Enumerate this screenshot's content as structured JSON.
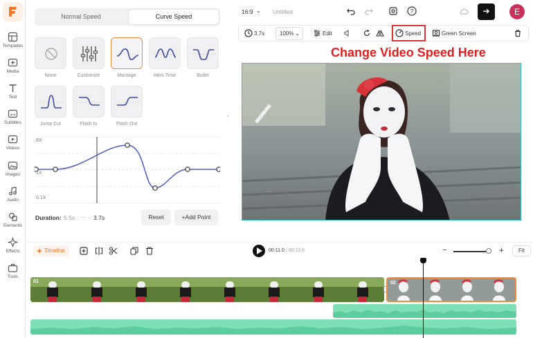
{
  "sidebar": {
    "items": [
      {
        "label": "Templates",
        "icon": "templates-icon"
      },
      {
        "label": "Media",
        "icon": "media-icon"
      },
      {
        "label": "Text",
        "icon": "text-icon"
      },
      {
        "label": "Subtitles",
        "icon": "subtitles-icon"
      },
      {
        "label": "Videos",
        "icon": "videos-icon"
      },
      {
        "label": "Images",
        "icon": "images-icon"
      },
      {
        "label": "Audio",
        "icon": "audio-icon"
      },
      {
        "label": "Elements",
        "icon": "elements-icon"
      },
      {
        "label": "Effects",
        "icon": "effects-icon"
      },
      {
        "label": "Tools",
        "icon": "tools-icon"
      }
    ]
  },
  "speed_panel": {
    "tabs": [
      "Normal Speed",
      "Curve Speed"
    ],
    "active_tab": "Curve Speed",
    "presets": [
      "None",
      "Customize",
      "Montage",
      "Hero Time",
      "Bullet",
      "Jump Cut",
      "Flash In",
      "Flash Out"
    ],
    "selected_preset": "Montage",
    "graph": {
      "y_max_label": "8X",
      "y_mid_label": "1X",
      "y_min_label": "0.1X"
    },
    "duration_label": "Duration:",
    "duration_original": "5.5s",
    "duration_new": "3.7s",
    "reset_label": "Reset",
    "add_point_label": "Add Point"
  },
  "topbar": {
    "aspect_ratio": "16:9",
    "project_title": "Untitled"
  },
  "toolbar": {
    "duration": "3.7s",
    "zoom": "100%",
    "edit_label": "Edit",
    "speed_label": "Speed",
    "green_screen_label": "Green Screen"
  },
  "annotation": "Change Video Speed Here",
  "timeline": {
    "label": "Timeline",
    "current_time": "00:11.0",
    "separator": " / ",
    "total_time": "00:13.6",
    "fit_label": "Fit",
    "clips": [
      {
        "number": "01"
      },
      {
        "number": "02"
      }
    ],
    "zoom_level": 0.9
  },
  "colors": {
    "accent": "#f08a3c",
    "brand": "#e8762c",
    "audio": "#7fe0b5",
    "selection": "#31c6d6",
    "annotation": "#e02020"
  }
}
